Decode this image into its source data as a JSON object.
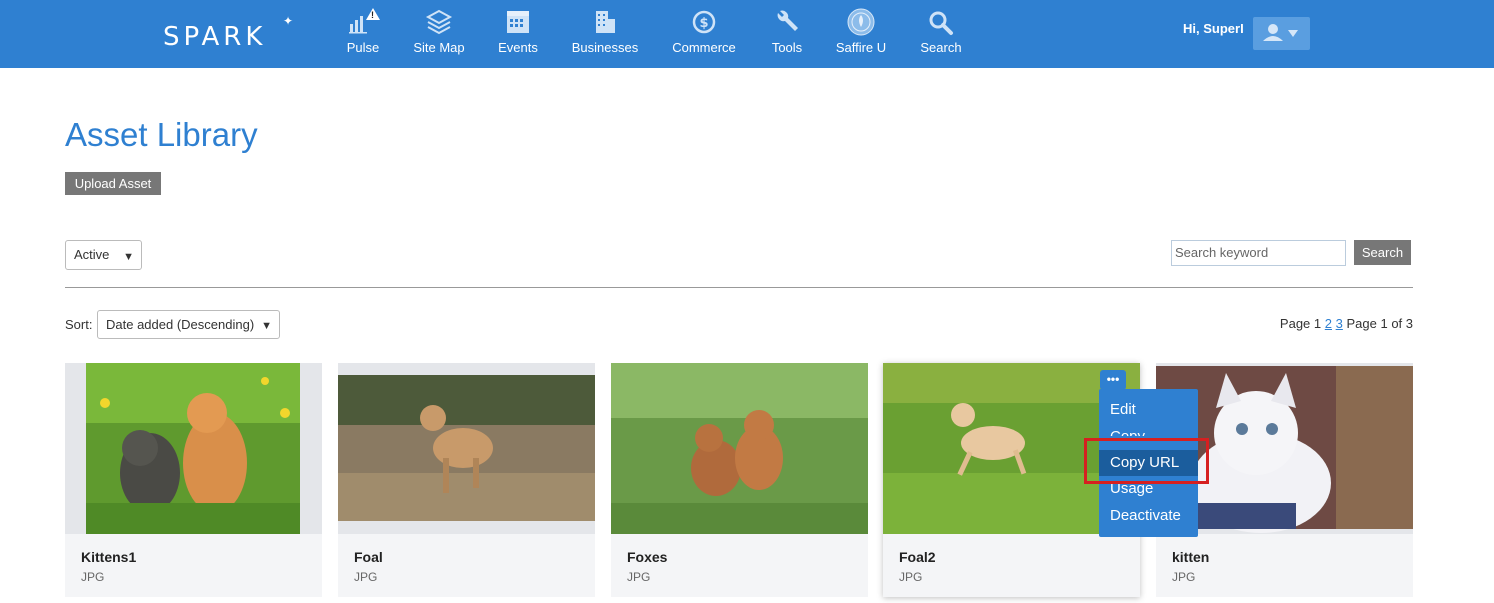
{
  "header": {
    "logo": "SPARK",
    "nav": [
      {
        "label": "Pulse",
        "icon": "pulse-chart-icon"
      },
      {
        "label": "Site Map",
        "icon": "layers-icon"
      },
      {
        "label": "Events",
        "icon": "calendar-icon"
      },
      {
        "label": "Businesses",
        "icon": "building-icon"
      },
      {
        "label": "Commerce",
        "icon": "dollar-icon"
      },
      {
        "label": "Tools",
        "icon": "wrench-icon"
      },
      {
        "label": "Saffire U",
        "icon": "saffire-seal-icon"
      },
      {
        "label": "Search",
        "icon": "search-icon"
      }
    ],
    "greeting": "Hi, SuperI",
    "alert_badge": "!"
  },
  "page": {
    "title": "Asset Library",
    "upload_label": "Upload Asset",
    "status_filter": "Active",
    "search_placeholder": "Search keyword",
    "search_label": "Search",
    "sort_label": "Sort:",
    "sort_value": "Date added (Descending)",
    "pager": {
      "prefix": "Page",
      "pages": [
        "1",
        "2",
        "3"
      ],
      "summary": "Page 1 of 3"
    }
  },
  "assets": [
    {
      "name": "Kittens1",
      "type": "JPG"
    },
    {
      "name": "Foal",
      "type": "JPG"
    },
    {
      "name": "Foxes",
      "type": "JPG"
    },
    {
      "name": "Foal2",
      "type": "JPG"
    },
    {
      "name": "kitten",
      "type": "JPG"
    }
  ],
  "context_menu": {
    "toggle": "•••",
    "items": [
      "Edit",
      "Copy",
      "Copy URL",
      "Usage",
      "Deactivate"
    ],
    "highlighted": "Copy URL"
  },
  "colors": {
    "brand": "#2f80d1",
    "menu_highlight": "#1b5d9d",
    "annotation": "#d62020"
  }
}
